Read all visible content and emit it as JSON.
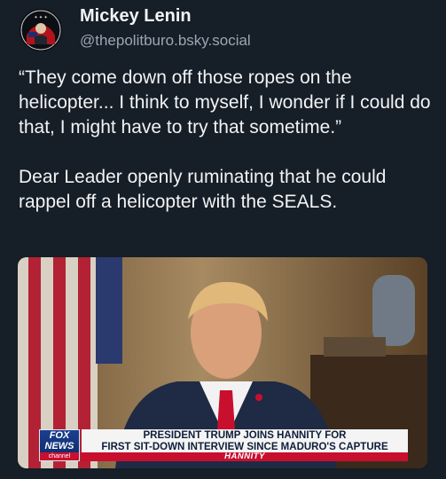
{
  "author": {
    "display_name": "Mickey Lenin",
    "handle": "@thepolitburo.bsky.social"
  },
  "post": {
    "quote": "“They come down off those ropes on the helicopter... I think to myself, I wonder if I could do that, I might have to try that sometime.”",
    "comment": "Dear Leader openly ruminating that he could rappel off a helicopter with the SEALS."
  },
  "media": {
    "network_logo": {
      "fox": "FOX",
      "news": "NEWS",
      "channel": "channel"
    },
    "headline_line1": "PRESIDENT TRUMP JOINS HANNITY FOR",
    "headline_line2": "FIRST SIT-DOWN INTERVIEW SINCE MADURO'S CAPTURE",
    "show_name": "HANNITY"
  },
  "colors": {
    "background": "#161e27",
    "text_primary": "#f1f3f5",
    "text_secondary": "#9aa7b4",
    "fox_blue": "#0c2a6b",
    "fox_red": "#c8102e"
  }
}
